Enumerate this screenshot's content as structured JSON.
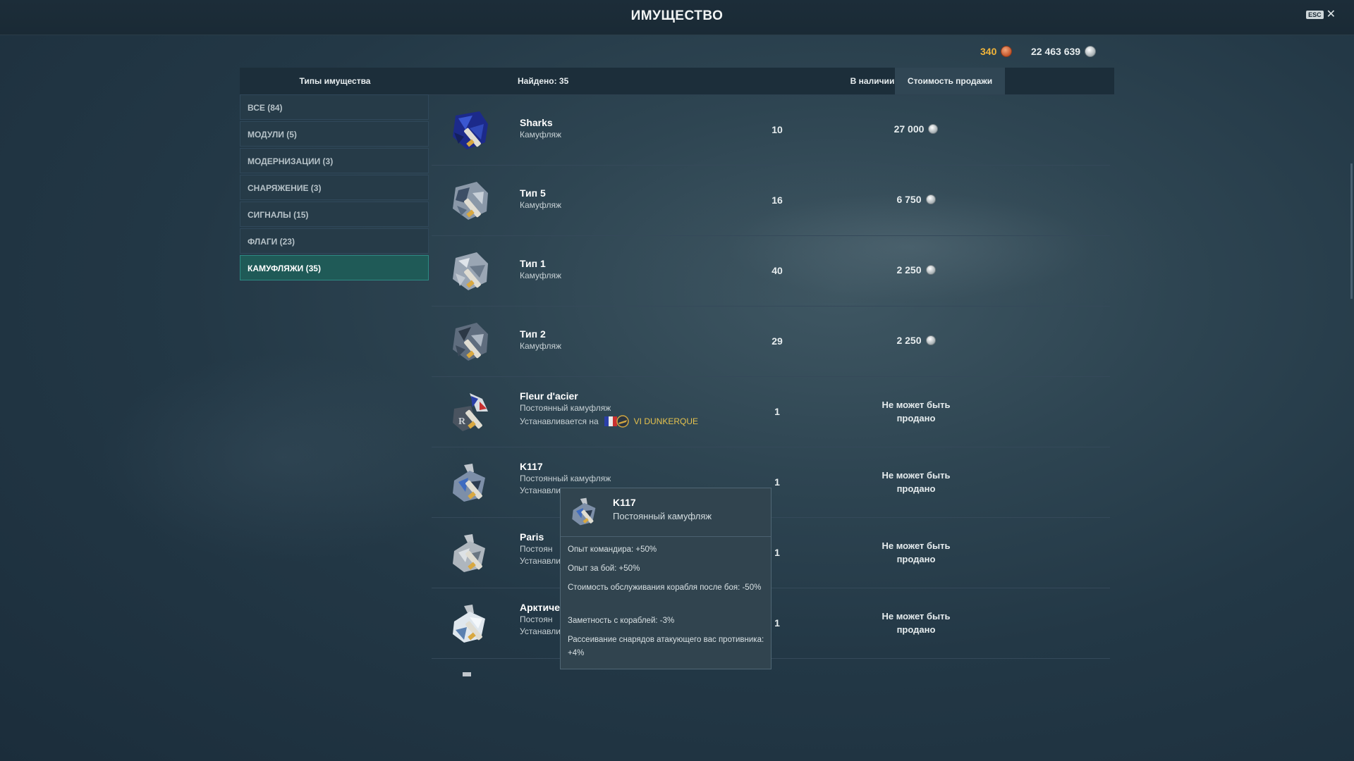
{
  "window": {
    "title": "ИМУЩЕСТВО",
    "esc_label": "ESC",
    "close_glyph": "✕"
  },
  "currency": {
    "doubloons": "340",
    "credits": "22 463 639",
    "doubloon_icon": "doubloon-icon",
    "credit_icon": "credit-icon"
  },
  "header": {
    "types": "Типы имущества",
    "found": "Найдено: 35",
    "in_stock": "В наличии",
    "sale_price": "Стоимость продажи"
  },
  "sidebar": {
    "items": [
      {
        "label": "ВСЕ (84)"
      },
      {
        "label": "МОДУЛИ (5)"
      },
      {
        "label": "МОДЕРНИЗАЦИИ (3)"
      },
      {
        "label": "СНАРЯЖЕНИЕ (3)"
      },
      {
        "label": "СИГНАЛЫ (15)"
      },
      {
        "label": "ФЛАГИ (23)"
      },
      {
        "label": "КАМУФЛЯЖИ (35)"
      }
    ],
    "active_index": 6
  },
  "items": [
    {
      "name": "Sharks",
      "type": "Камуфляж",
      "qty": "10",
      "price": "27 000"
    },
    {
      "name": "Тип 5",
      "type": "Камуфляж",
      "qty": "16",
      "price": "6 750"
    },
    {
      "name": "Тип 1",
      "type": "Камуфляж",
      "qty": "40",
      "price": "2 250"
    },
    {
      "name": "Тип 2",
      "type": "Камуфляж",
      "qty": "29",
      "price": "2 250"
    },
    {
      "name": "Fleur d'acier",
      "type": "Постоянный камуфляж",
      "installed_label": "Устанавливается на",
      "ship": "VI DUNKERQUE",
      "qty": "1",
      "price_line1": "Не может быть",
      "price_line2": "продано"
    },
    {
      "name": "K117",
      "type": "Постоянный камуфляж",
      "installed_label": "Устанавли",
      "qty": "1",
      "price_line1": "Не может быть",
      "price_line2": "продано"
    },
    {
      "name": "Paris",
      "type": "Постоян",
      "installed_label": "Устанавли",
      "qty": "1",
      "price_line1": "Не может быть",
      "price_line2": "продано"
    },
    {
      "name": "Арктиче",
      "type": "Постоян",
      "installed_label": "Устанавли",
      "qty": "1",
      "price_line1": "Не может быть",
      "price_line2": "продано"
    }
  ],
  "tooltip": {
    "title": "K117",
    "subtitle": "Постоянный камуфляж",
    "bonuses": [
      "Опыт командира: +50%",
      "Опыт за бой: +50%",
      "Стоимость обслуживания корабля после боя: -50%",
      "Заметность с кораблей: -3%",
      "Рассеивание снарядов атакующего вас противника: +4%"
    ]
  },
  "colors": {
    "accent_active": "#1f5a57",
    "doubloon": "#f0b43a",
    "ship_name": "#e6c24e",
    "bg": "#233846"
  }
}
